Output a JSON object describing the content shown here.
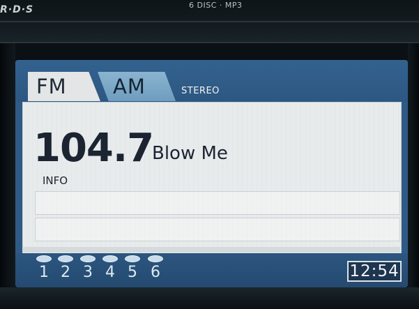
{
  "bezel": {
    "rds_label": "R·D·S",
    "disc_label": "6 DISC · MP3"
  },
  "tabs": [
    {
      "label": "FM",
      "active": true
    },
    {
      "label": "AM",
      "active": false
    }
  ],
  "stereo_label": "STEREO",
  "frequency": "104.7",
  "station_name": "Blow Me",
  "info_label": "INFO",
  "presets": [
    {
      "label": "1"
    },
    {
      "label": "2"
    },
    {
      "label": "3"
    },
    {
      "label": "4"
    },
    {
      "label": "5"
    },
    {
      "label": "6"
    }
  ],
  "clock": "12:54",
  "colors": {
    "screen_blue": "#2f5a86",
    "panel": "#e8ebec",
    "text_dark": "#1b2430",
    "tab_am": "#7ea8c8"
  }
}
